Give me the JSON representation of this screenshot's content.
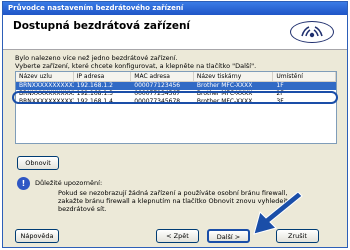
{
  "window": {
    "title": "Průvodce nastavením bezdrátového zařízení"
  },
  "header": {
    "title": "Dostupná bezdrátová zařízení"
  },
  "instructions": {
    "line1": "Bylo nalezeno více než jedno bezdrátové zařízení.",
    "line2": "Vyberte zařízení, které chcete konfigurovat, a klepněte na tlačítko \"Další\"."
  },
  "device_list": {
    "columns": [
      "Název uzlu",
      "IP adresa",
      "MAC adresa",
      "Název tiskárny",
      "Umístění"
    ],
    "rows": [
      [
        "BRNXXXXXXXXXXXX",
        "192.168.1.2",
        "000077123456",
        "Brother MFC-XXXX",
        "1F"
      ],
      [
        "BRNXXXXXXXXXXXX",
        "192.168.1.3",
        "000077234567",
        "Brother MFC-XXXX",
        "2F"
      ],
      [
        "BRNXXXXXXXXXXXX",
        "192.168.1.4",
        "000077345678",
        "Brother MFC-XXXX",
        "3F"
      ]
    ],
    "selected_index": 0
  },
  "buttons": {
    "refresh": "Obnovit",
    "help": "Nápověda",
    "back": "< Zpět",
    "next": "Další >",
    "cancel": "Zrušit"
  },
  "note": {
    "title": "Důležité upozornění:",
    "text": "Pokud se nezobrazují žádná zařízení a používáte osobní bránu firewall, zakažte bránu firewall a klepnutím na tlačítko Obnovit znovu vyhledejte bezdrátové sít."
  },
  "icons": {
    "logo": "brother-logo-icon",
    "info": "info-icon",
    "arrow": "pointer-arrow-icon"
  },
  "colors": {
    "titlebar": "#1f55c7",
    "selection": "#316ac5",
    "highlight": "#1a4ea8"
  }
}
